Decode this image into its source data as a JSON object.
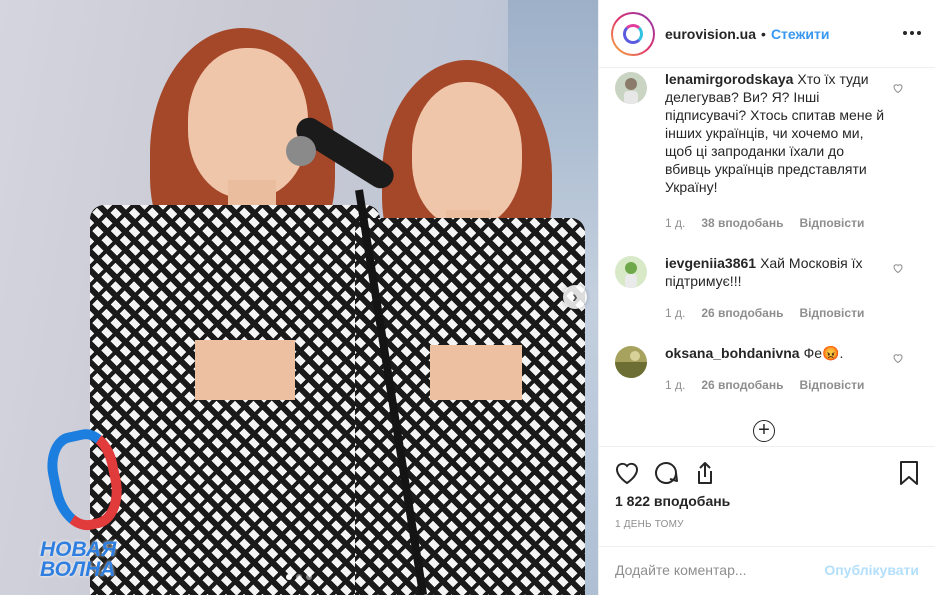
{
  "photo": {
    "logo_line1": "НОВАЯ",
    "logo_line2": "ВОЛНА",
    "next_arrow": "›",
    "carousel_total": 3,
    "carousel_active": 1
  },
  "header": {
    "username": "eurovision.ua",
    "separator": "•",
    "follow_label": "Стежити",
    "more_icon": "more-options-icon"
  },
  "comments": [
    {
      "username": "lenamirgorodskaya",
      "text": "Хто їх туди делегував? Ви? Я? Інші підписувачі? Хтось спитав мене й інших українців, чи хочемо ми, щоб ці запроданки їхали до вбивць українців представляти Україну!",
      "time": "1 д.",
      "likes": "38 вподобань",
      "reply": "Відповісти"
    },
    {
      "username": "ievgeniia3861",
      "text": "Хай Московія їх підтримує!!!",
      "time": "1 д.",
      "likes": "26 вподобань",
      "reply": "Відповісти"
    },
    {
      "username": "oksana_bohdanivna",
      "text": "Фе😡.",
      "time": "1 д.",
      "likes": "26 вподобань",
      "reply": "Відповісти"
    }
  ],
  "load_more_label": "+",
  "actions": {
    "icons": [
      "heart-icon",
      "comment-icon",
      "share-icon",
      "bookmark-icon"
    ],
    "likes_count": "1 822 вподобань",
    "timestamp": "1 ДЕНЬ ТОМУ"
  },
  "add_comment": {
    "placeholder": "Додайте коментар...",
    "publish_label": "Опублікувати"
  },
  "colors": {
    "accent": "#3897f0",
    "publish_disabled": "#b2dffc",
    "secondary_text": "#8e8e8e",
    "primary_text": "#262626"
  }
}
